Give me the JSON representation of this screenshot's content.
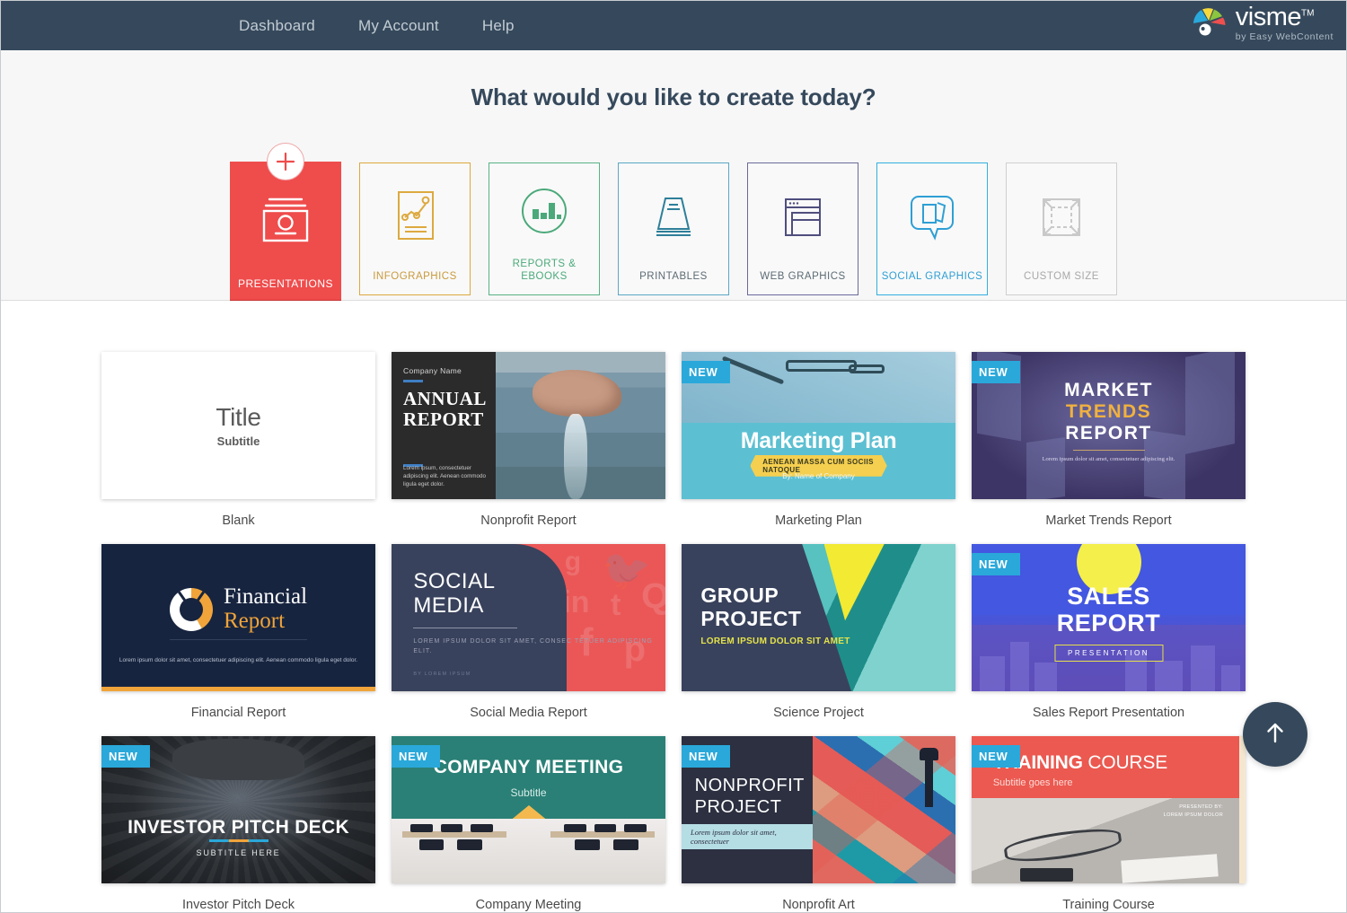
{
  "nav": {
    "links": [
      {
        "label": "Dashboard",
        "name": "nav-dashboard"
      },
      {
        "label": "My Account",
        "name": "nav-my-account"
      },
      {
        "label": "Help",
        "name": "nav-help"
      }
    ],
    "logo": {
      "word": "visme",
      "tm": "TM",
      "tagline": "by Easy WebContent"
    }
  },
  "hero": {
    "title": "What would you like to create today?",
    "types": [
      {
        "label": "PRESENTATIONS",
        "icon": "presentation-icon",
        "active": true,
        "color": "#ef4c4c"
      },
      {
        "label": "INFOGRAPHICS",
        "icon": "infographic-icon",
        "active": false,
        "color": "#dda93f"
      },
      {
        "label": "REPORTS & EBOOKS",
        "icon": "bar-chart-circle-icon",
        "active": false,
        "color": "#58b384"
      },
      {
        "label": "PRINTABLES",
        "icon": "printables-icon",
        "active": false,
        "color": "#5aa8c4"
      },
      {
        "label": "WEB GRAPHICS",
        "icon": "browser-window-icon",
        "active": false,
        "color": "#6b6a9c"
      },
      {
        "label": "SOCIAL GRAPHICS",
        "icon": "speech-bubble-cards-icon",
        "active": false,
        "color": "#34aee0"
      },
      {
        "label": "CUSTOM SIZE",
        "icon": "resize-arrows-icon",
        "active": false,
        "color": "#cfcfcf"
      }
    ]
  },
  "templates": [
    {
      "name": "Blank",
      "badge": null,
      "preview": {
        "title": "Title",
        "subtitle": "Subtitle"
      }
    },
    {
      "name": "Nonprofit Report",
      "badge": null,
      "preview": {
        "company": "Company Name",
        "line1": "ANNUAL",
        "line2": "REPORT",
        "lorem": "Lorem ipsum, consectetuer adipiscing elit. Aenean commodo ligula eget dolor."
      }
    },
    {
      "name": "Marketing Plan",
      "badge": "NEW",
      "preview": {
        "title": "Marketing Plan",
        "ribbon": "AENEAN MASSA CUM SOCIIS NATOQUE",
        "byline": "By: Name of Company"
      }
    },
    {
      "name": "Market Trends Report",
      "badge": "NEW",
      "preview": {
        "line1": "MARKET",
        "line2": "TRENDS",
        "line3": "REPORT",
        "sub": "Lorem ipsum dolor sit amet, consectetuer adipiscing elit."
      }
    },
    {
      "name": "Financial Report",
      "badge": null,
      "preview": {
        "word1": "Financial",
        "word2": "Report",
        "lorem": "Lorem ipsum dolor sit amet, consectetuer adipiscing elit. Aenean commodo ligula eget dolor."
      }
    },
    {
      "name": "Social Media Report",
      "badge": null,
      "preview": {
        "line1": "SOCIAL",
        "line2": "MEDIA",
        "lorem": "LOREM IPSUM DOLOR SIT AMET, CONSEC TETUER ADIPISCING ELIT.",
        "by": "BY LOREM IPSUM"
      }
    },
    {
      "name": "Science Project",
      "badge": null,
      "preview": {
        "line1": "GROUP",
        "line2": "PROJECT",
        "sub": "LOREM IPSUM DOLOR SIT AMET"
      }
    },
    {
      "name": "Sales Report Presentation",
      "badge": "NEW",
      "preview": {
        "line1": "SALES",
        "line2": "REPORT",
        "tag": "PRESENTATION"
      }
    },
    {
      "name": "Investor Pitch Deck",
      "badge": "NEW",
      "preview": {
        "title": "INVESTOR PITCH DECK",
        "subtitle": "SUBTITLE HERE"
      }
    },
    {
      "name": "Company Meeting",
      "badge": "NEW",
      "preview": {
        "title": "COMPANY MEETING",
        "subtitle": "Subtitle"
      }
    },
    {
      "name": "Nonprofit Art",
      "badge": "NEW",
      "preview": {
        "line1": "NONPROFIT",
        "line2": "PROJECT",
        "band": "Lorem ipsum dolor sit amet, consectetuer"
      }
    },
    {
      "name": "Training Course",
      "badge": "NEW",
      "preview": {
        "title_bold": "TRAINING",
        "title_rest": " COURSE",
        "subtitle": "Subtitle goes here",
        "presented_by": "PRESENTED BY:",
        "presenter": "LOREM IPSUM DOLOR"
      }
    }
  ],
  "fab": {
    "icon": "arrow-up-icon",
    "name": "scroll-to-top-button"
  }
}
